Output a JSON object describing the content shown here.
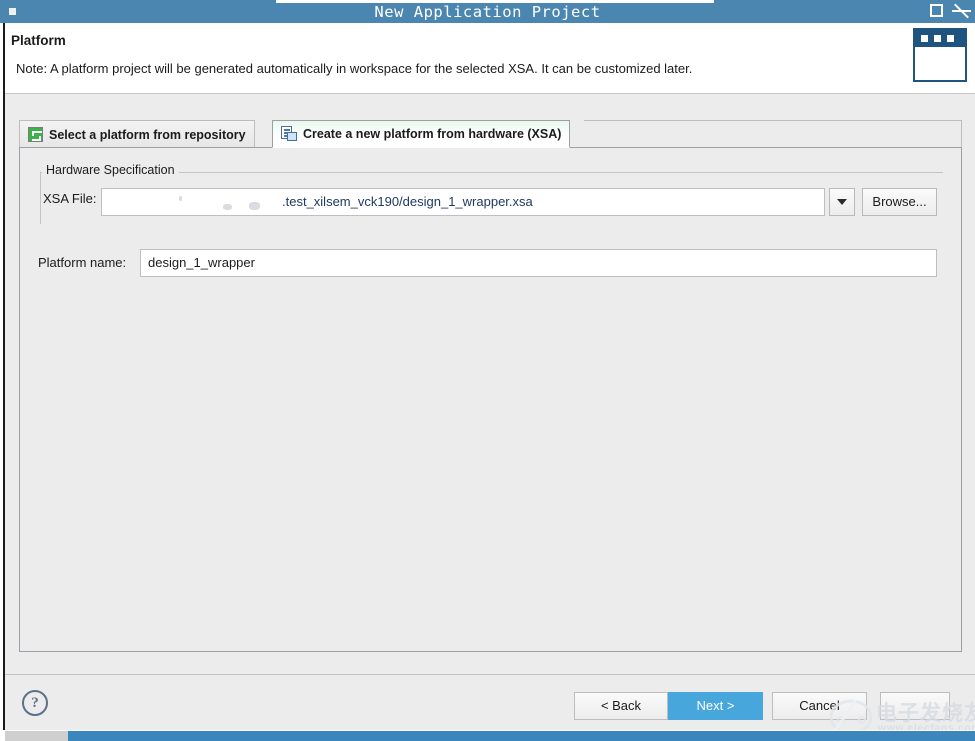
{
  "window": {
    "title": "New Application Project",
    "maximize_label": "Maximize",
    "close_label": "Close",
    "menu_label": "Window menu"
  },
  "header": {
    "title": "Platform",
    "note": "Note: A platform project will be generated automatically in workspace for the selected XSA. It can be customized later.",
    "icon": "new-application-project-icon"
  },
  "tabs": [
    {
      "id": "select-platform-from-repository",
      "label": "Select a platform from repository",
      "icon": "repository-icon",
      "active": false
    },
    {
      "id": "create-new-platform-from-hardware",
      "label": "Create a new platform from hardware (XSA)",
      "icon": "hardware-xsa-icon",
      "active": true
    }
  ],
  "hardware_specification": {
    "group_label": "Hardware Specification",
    "xsa_file": {
      "label": "XSA File:",
      "value": ".test_xilsem_vck190/design_1_wrapper.xsa",
      "placeholder": "",
      "dropdown_icon": "chevron-down-icon",
      "browse_label": "Browse..."
    },
    "platform_name": {
      "label": "Platform name:",
      "value": "design_1_wrapper",
      "placeholder": ""
    }
  },
  "footer": {
    "help_label": "?",
    "buttons": [
      {
        "id": "back",
        "label": "< Back",
        "primary": false
      },
      {
        "id": "next",
        "label": "Next >",
        "primary": true
      },
      {
        "id": "cancel",
        "label": "Cancel",
        "primary": false
      },
      {
        "id": "finish",
        "label": "",
        "primary": false
      }
    ]
  },
  "watermark": {
    "text_cn": "电子发烧友",
    "url": "www.elecfans.com"
  },
  "colors": {
    "titlebar": "#4a86b0",
    "accent_button": "#47a7dd",
    "dialog_bg": "#ececed",
    "header_bg": "#ffffff",
    "header_icon": "#1f5480",
    "tab_icon_green": "#3bb24a",
    "field_text": "#1f3a63"
  }
}
